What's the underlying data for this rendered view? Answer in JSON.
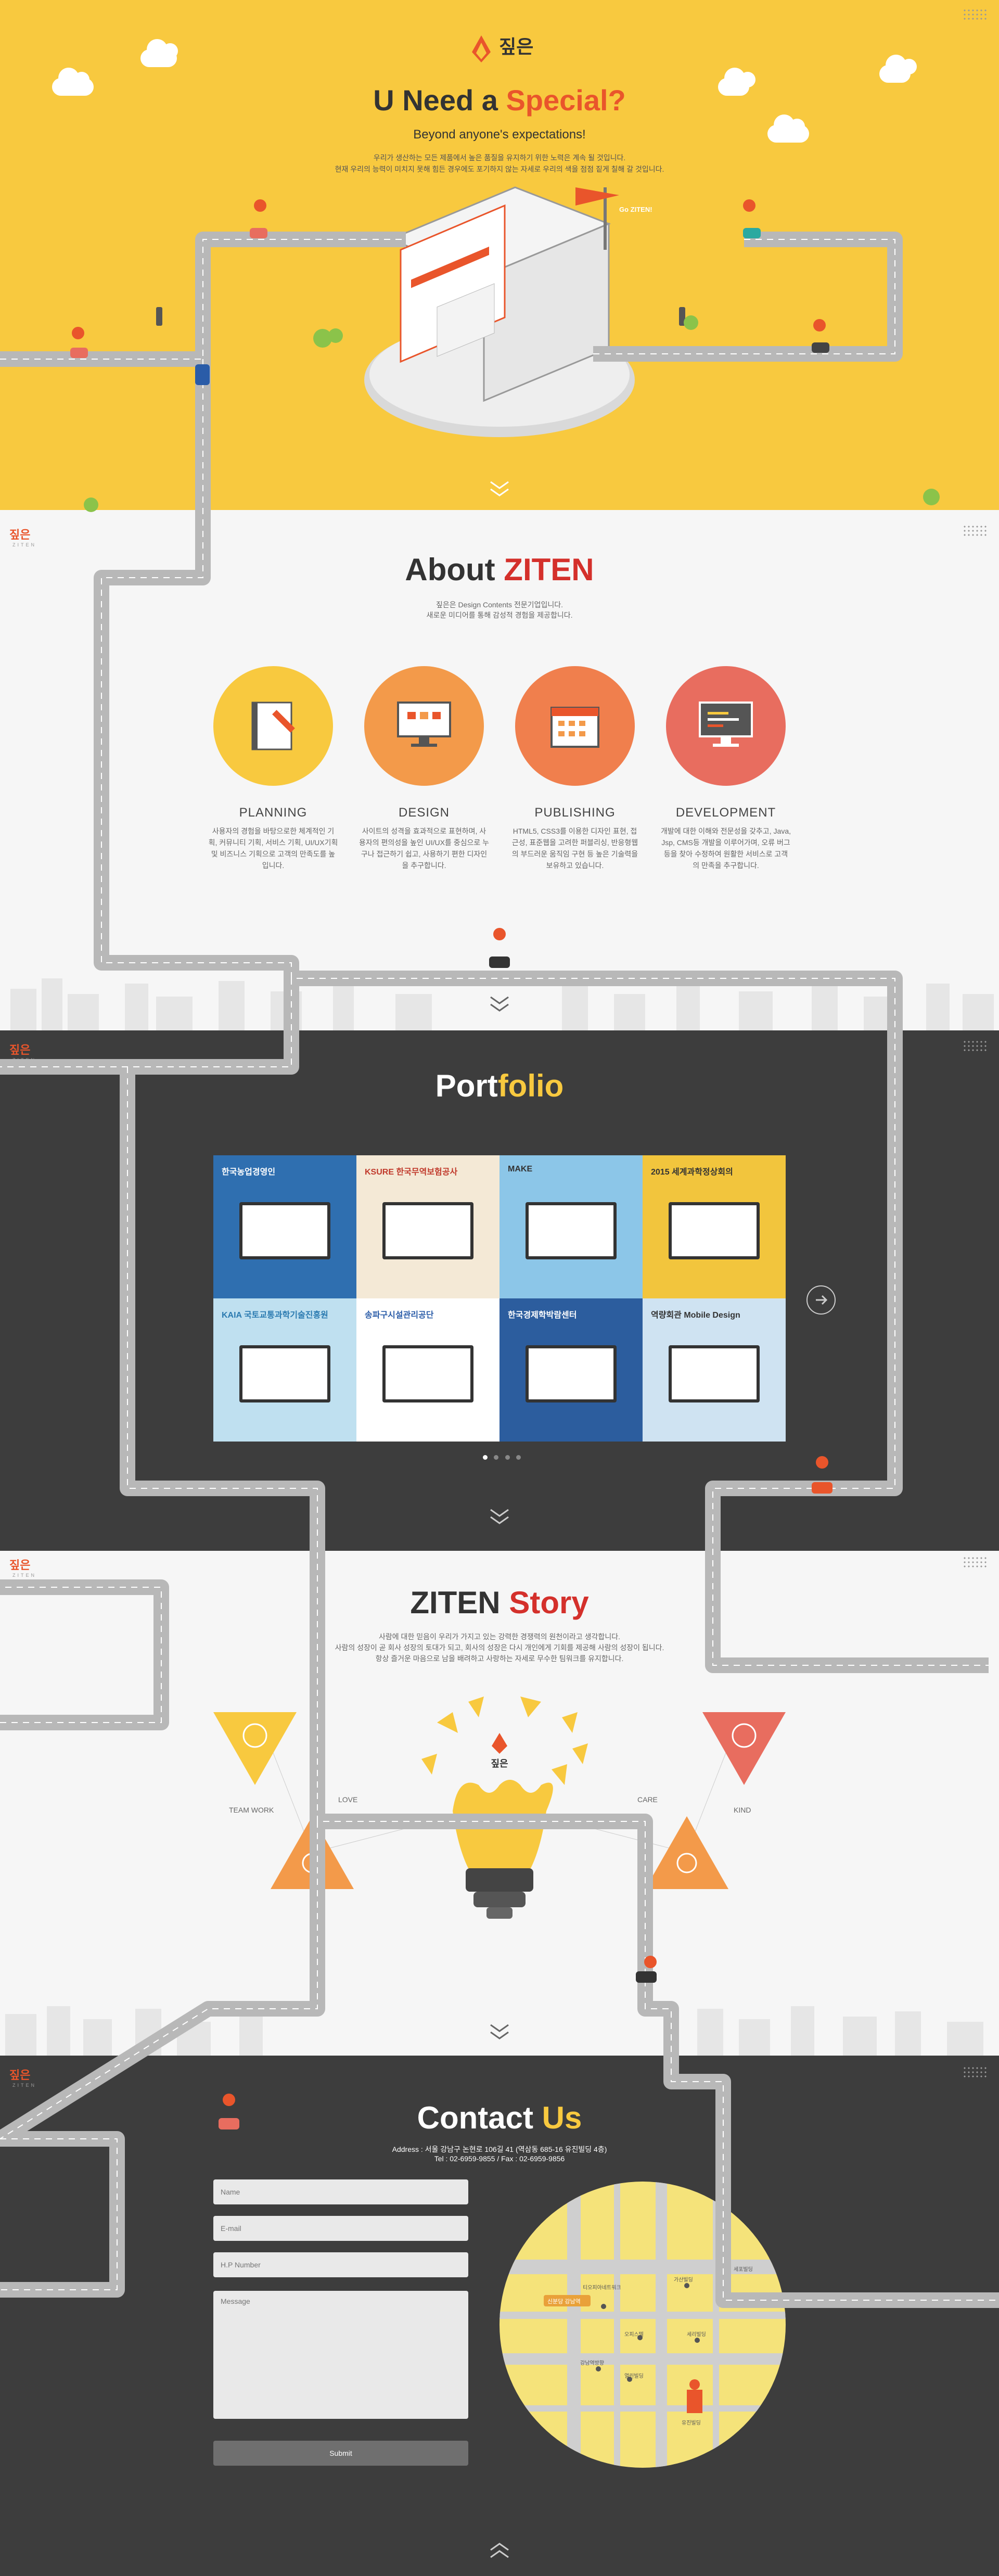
{
  "brand": {
    "logo_text": "짚은",
    "logo_sub": "ZITEN"
  },
  "hero": {
    "title_a": "U Need a ",
    "title_b": "Special?",
    "subtitle": "Beyond anyone's expectations!",
    "line1": "우리가 생산하는 모든 제품에서 높은 품질을 유지하기 위한 노력은 계속 될 것입니다.",
    "line2": "현재 우리의 능력이 미치지 못해 힘든 경우에도 포기하지 않는 자세로 우리의 색을 점점 짙게 칠해 갈 것입니다.",
    "flag": "Go ZITEN!"
  },
  "about": {
    "title_a": "About ",
    "title_b": "ZITEN",
    "line1": "짚은은 Design Contents 전문기업입니다.",
    "line2": "새로운 미디어를 통해 감성적 경험을 제공합니다.",
    "services": [
      {
        "title": "PLANNING",
        "color": "#f8c93f",
        "desc": "사용자의 경험을 바탕으로한 체계적인 기획, 커뮤니티 기획, 서비스 기획, UI/UX기획 및 비즈니스 기획으로 고객의 만족도를 높입니다."
      },
      {
        "title": "DESIGN",
        "color": "#f39a4a",
        "desc": "사이트의 성격을 효과적으로 표현하며, 사용자의 편의성을 높인 UI/UX를 중심으로 누구나 접근하기 쉽고, 사용하기 편한 디자인을 추구합니다."
      },
      {
        "title": "PUBLISHING",
        "color": "#f07f4d",
        "desc": "HTML5, CSS3를 이용한 디자인 표현, 접근성, 표준웹을 고려한 퍼블리싱, 반응형웹의 부드러운 움직임 구현 등 높은 기술력을 보유하고 있습니다."
      },
      {
        "title": "DEVELOPMENT",
        "color": "#e86d5f",
        "desc": "개발에 대한 이해와 전문성을 갖추고, Java, Jsp, CMS등 개발을 이루어가며, 오류 버그등을 찾아 수정하여 원활한 서비스로 고객의 만족을 추구합니다."
      }
    ]
  },
  "portfolio": {
    "title_a": "Port",
    "title_b": "folio",
    "tiles": [
      {
        "label": "한국농업경영인",
        "bg": "#2f6fb0",
        "fg": "#ffffff"
      },
      {
        "label": "KSURE 한국무역보험공사",
        "bg": "#f4e9d6",
        "fg": "#c0392b"
      },
      {
        "label": "MAKE",
        "bg": "#8cc6e8",
        "fg": "#333333"
      },
      {
        "label": "2015 세계과학정상회의",
        "bg": "#f2c53d",
        "fg": "#333333"
      },
      {
        "label": "KAIA 국토교통과학기술진흥원",
        "bg": "#bfe0f0",
        "fg": "#2a7ab0"
      },
      {
        "label": "송파구시설관리공단",
        "bg": "#ffffff",
        "fg": "#2a5ca8"
      },
      {
        "label": "한국경제학박람센터",
        "bg": "#2c5d9e",
        "fg": "#ffffff"
      },
      {
        "label": "역량회관 Mobile Design",
        "bg": "#cfe3f2",
        "fg": "#333333"
      }
    ]
  },
  "story": {
    "title_a": "ZITEN ",
    "title_b": "Story",
    "line1": "사람에 대한 믿음이 우리가 가지고 있는 강력한 경쟁력의 원천이라고 생각합니다.",
    "line2": "사람의 성장이 곧 회사 성장의 토대가 되고, 회사의 성장은 다시 개인에게 기회를 제공해 사람의 성장이 됩니다.",
    "line3": "항상 즐거운 마음으로 남을 배려하고 사랑하는 자세로 무수한 팀워크를 유지합니다.",
    "values": {
      "teamwork": "TEAM WORK",
      "love": "LOVE",
      "care": "CARE",
      "kind": "KIND"
    }
  },
  "contact": {
    "title_a": "Contact ",
    "title_b": "Us",
    "address": "Address : 서울 강남구 논현로 106길 41 (역삼동 685-16 유진빌딩 4층)",
    "tel": "Tel : 02-6959-9855 / Fax : 02-6959-9856",
    "name_ph": "Name",
    "email_ph": "E-mail",
    "phone_ph": "H.P Number",
    "message_ph": "Message",
    "submit": "Submit",
    "map": {
      "station": "신분당 강남역",
      "labels": [
        "티오피아네트워크",
        "가산빌딩",
        "오피스텔",
        "세리빌딩",
        "강남역방향",
        "세포빌딩",
        "열린빌딩",
        "유진빌딩"
      ]
    }
  },
  "colors": {
    "yellow": "#f8c93f",
    "orange": "#e9552b",
    "dark": "#3d3d3d",
    "road": "#b8b8b8"
  }
}
